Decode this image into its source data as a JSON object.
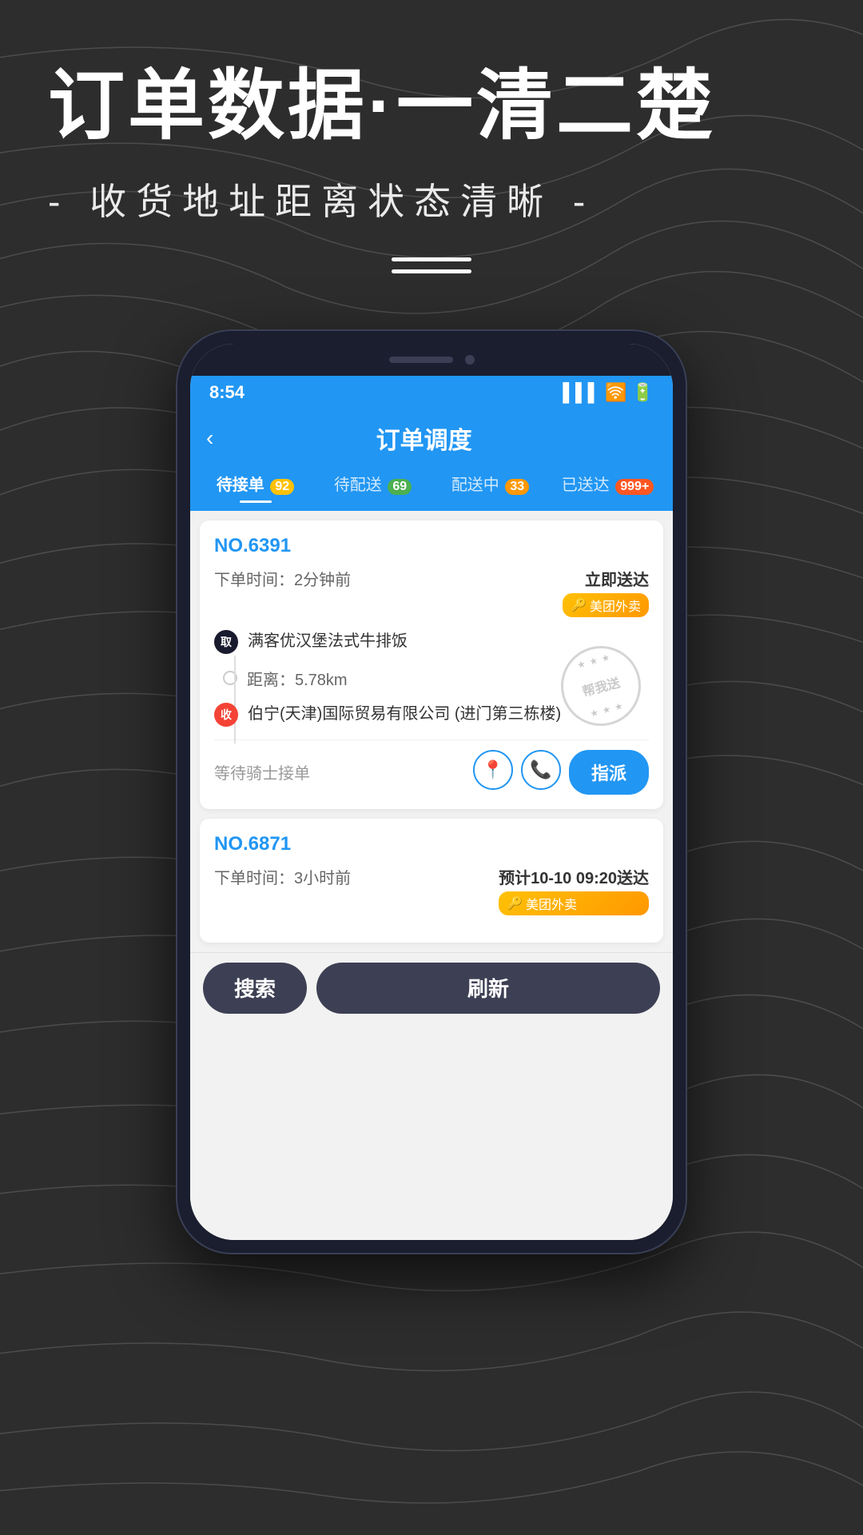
{
  "background": {
    "color": "#2a2a2a"
  },
  "header": {
    "main_title": "订单数据·一清二楚",
    "sub_title": "- 收货地址距离状态清晰 -"
  },
  "phone": {
    "status_bar": {
      "time": "8:54"
    },
    "app_header": {
      "title": "订单调度",
      "back_label": "‹"
    },
    "tabs": [
      {
        "label": "待接单",
        "badge": "92",
        "badge_type": "yellow",
        "active": true
      },
      {
        "label": "待配送",
        "badge": "69",
        "badge_type": "green",
        "active": false
      },
      {
        "label": "配送中",
        "badge": "33",
        "badge_type": "orange",
        "active": false
      },
      {
        "label": "已送达",
        "badge": "999+",
        "badge_type": "red-orange",
        "active": false
      }
    ],
    "orders": [
      {
        "id": "NO.6391",
        "time": "下单时间：2分钟前",
        "delivery_type": "立即送达",
        "platform": "美团外卖",
        "pickup_name": "满客优汉堡法式牛排饭",
        "distance": "距离：5.78km",
        "delivery_address": "伯宁(天津)国际贸易有限公司 (进门第三栋楼)",
        "status": "等待骑士接单",
        "stamp_text": "帮我送",
        "btn_assign": "指派"
      },
      {
        "id": "NO.6871",
        "time": "下单时间：3小时前",
        "delivery_type": "预计10-10 09:20送达",
        "platform": "美团外卖"
      }
    ],
    "bottom_bar": {
      "search_label": "搜索",
      "refresh_label": "刷新"
    }
  }
}
